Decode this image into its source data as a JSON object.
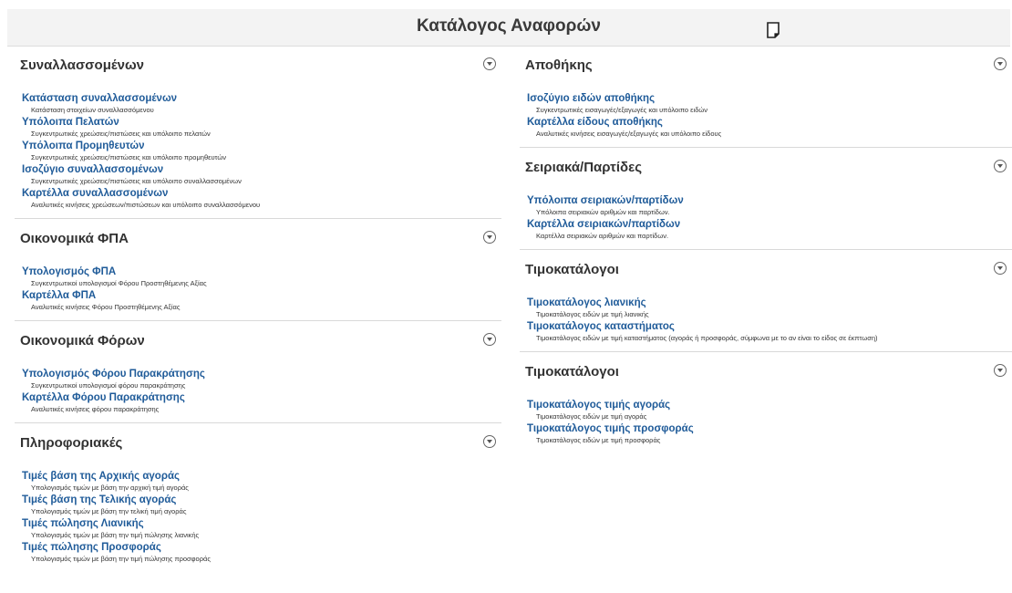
{
  "header": {
    "title": "Κατάλογος Αναφορών"
  },
  "left_sections": [
    {
      "title": "Συναλλασσομένων",
      "items": [
        {
          "title": "Κατάσταση συναλλασσομένων",
          "desc": "Κατάσταση στοιχείων συναλλασσόμενου"
        },
        {
          "title": "Υπόλοιπα Πελατών",
          "desc": "Συγκεντρωτικές χρεώσεις/πιστώσεις και υπόλοιπο πελατών"
        },
        {
          "title": "Υπόλοιπα Προμηθευτών",
          "desc": "Συγκεντρωτικές χρεώσεις/πιστώσεις και υπόλοιπο προμηθευτών"
        },
        {
          "title": "Ισοζύγιο συναλλασσομένων",
          "desc": "Συγκεντρωτικές χρεώσεις/πιστώσεις και υπόλοιπο συναλλασσομένων"
        },
        {
          "title": "Καρτέλλα συναλλασσομένων",
          "desc": "Αναλυτικές κινήσεις χρεώσεων/πιστώσεων και υπόλοιπο συναλλασσόμενου"
        }
      ]
    },
    {
      "title": "Οικονομικά ΦΠΑ",
      "items": [
        {
          "title": "Υπολογισμός ΦΠΑ",
          "desc": "Συγκεντρωτικοί υπολογισμοί Φόρου Προστηθέμενης Αξίας"
        },
        {
          "title": "Καρτέλλα ΦΠΑ",
          "desc": "Αναλυτικές κινήσεις Φόρου Προστηθέμενης Αξίας"
        }
      ]
    },
    {
      "title": "Οικονομικά Φόρων",
      "items": [
        {
          "title": "Υπολογισμός Φόρου Παρακράτησης",
          "desc": "Συγκεντρωτικοί υπολογισμοί φόρου παρακράτησης"
        },
        {
          "title": "Καρτέλλα Φόρου Παρακράτησης",
          "desc": "Αναλυτικές κινήσεις φόρου παρακράτησης"
        }
      ]
    },
    {
      "title": "Πληροφοριακές",
      "items": [
        {
          "title": "Τιμές βάση της Αρχικής αγοράς",
          "desc": "Υπολογισμός τιμών με βάση την αρχική τιμή αγοράς"
        },
        {
          "title": "Τιμές βάση της Τελικής αγοράς",
          "desc": "Υπολογισμός τιμών με βάση την τελική τιμή αγοράς"
        },
        {
          "title": "Τιμές πώλησης Λιανικής",
          "desc": "Υπολογισμός τιμών με βάση την τιμή πώλησης λιανικής"
        },
        {
          "title": "Τιμές πώλησης Προσφοράς",
          "desc": "Υπολογισμός τιμών με βάση την τιμή πώλησης προσφοράς"
        }
      ]
    }
  ],
  "right_sections": [
    {
      "title": "Αποθήκης",
      "items": [
        {
          "title": "Ισοζύγιο ειδών αποθήκης",
          "desc": "Συγκεντρωτικές εισαγωγές/εξαγωγές και υπόλοιπο ειδών"
        },
        {
          "title": "Καρτέλλα είδους αποθήκης",
          "desc": "Αναλυτικές κινήσεις εισαγωγές/εξαγωγές και υπόλοιπο είδους"
        }
      ]
    },
    {
      "title": "Σειριακά/Παρτίδες",
      "items": [
        {
          "title": "Υπόλοιπα σειριακών/παρτίδων",
          "desc": "Υπόλοιπα σειριακών αριθμών και παρτίδων."
        },
        {
          "title": "Καρτέλλα σειριακών/παρτίδων",
          "desc": "Καρτέλλα σειριακών αριθμών και παρτίδων."
        }
      ]
    },
    {
      "title": "Τιμοκατάλογοι",
      "items": [
        {
          "title": "Τιμοκατάλογος λιανικής",
          "desc": "Τιμοκατάλογος ειδών με τιμή λιανικής"
        },
        {
          "title": "Τιμοκατάλογος καταστήματος",
          "desc": "Τιμοκατάλογος ειδών με τιμή καταστήματος (αγοράς ή προσφοράς, σύμφωνα με το αν είναι το είδος σε έκπτωση)"
        }
      ]
    },
    {
      "title": "Τιμοκατάλογοι",
      "items": [
        {
          "title": "Τιμοκατάλογος τιμής αγοράς",
          "desc": "Τιμοκατάλογος ειδών με τιμή αγοράς"
        },
        {
          "title": "Τιμοκατάλογος τιμής προσφοράς",
          "desc": "Τιμοκατάλογος ειδών με τιμή προσφοράς"
        }
      ]
    }
  ]
}
